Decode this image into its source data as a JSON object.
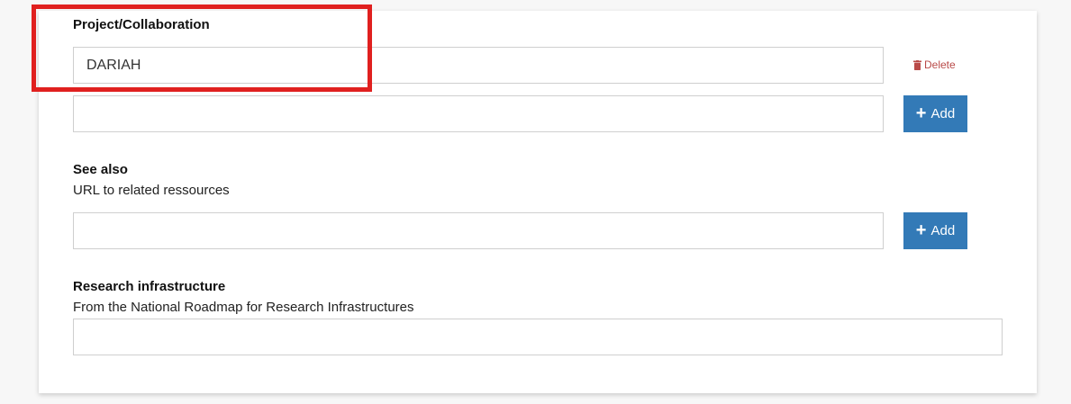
{
  "project": {
    "label": "Project/Collaboration",
    "value": "DARIAH",
    "delete_label": "Delete",
    "new_value": "",
    "add_label": "Add"
  },
  "see_also": {
    "label": "See also",
    "help": "URL to related ressources",
    "value": "",
    "add_label": "Add"
  },
  "research_infrastructure": {
    "label": "Research infrastructure",
    "help": "From the National Roadmap for Research Infrastructures",
    "value": ""
  },
  "colors": {
    "primary_button": "#337ab7",
    "delete": "#b94a48",
    "highlight": "#e0201f"
  }
}
